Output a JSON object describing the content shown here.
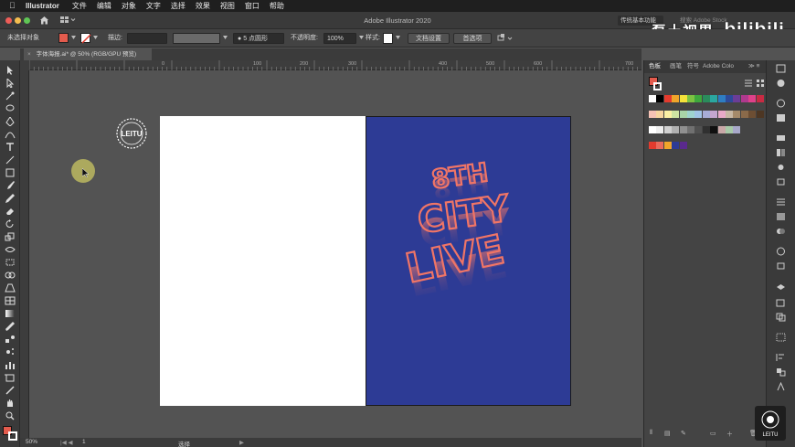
{
  "menubar": {
    "app_name": "Illustrator",
    "items": [
      "文件",
      "编辑",
      "对象",
      "文字",
      "选择",
      "效果",
      "视图",
      "窗口",
      "帮助"
    ]
  },
  "titlebar": {
    "title": "Adobe Illustrator 2020",
    "workspace": "传统基本功能",
    "search_placeholder": "搜索 Adobe Stock"
  },
  "watermark": {
    "text_cn": "磊土视界",
    "text_bili": "bilibili"
  },
  "control_bar": {
    "no_selection": "未选择对象",
    "stroke_label": "描边:",
    "brush_label": "5 点圆形",
    "opacity_label": "不透明度:",
    "opacity_value": "100%",
    "style_label": "样式:",
    "doc_setup_button": "文档设置",
    "preferences_button": "首选项",
    "fill_color": "#e35b4d"
  },
  "document_tab": {
    "title": "字体海报.ai* @ 50% (RGB/GPU 预览)"
  },
  "ruler_top_ticks": [
    "0",
    "100",
    "200",
    "300",
    "400",
    "500",
    "600",
    "700"
  ],
  "status_bar": {
    "zoom": "50%",
    "artboard_number": "1",
    "tool_name": "选择"
  },
  "artwork": {
    "lines": [
      "8TH",
      "CITY",
      "LIVE"
    ],
    "background_color": "#2d3b95",
    "text_color": "#e96a5c",
    "logo_text": "LEITU"
  },
  "swatches_panel": {
    "tabs": [
      "色板",
      "画笔",
      "符号",
      "Adobe Colo"
    ],
    "colors": [
      [
        "#ffffff",
        "#000000",
        "#e33b2e",
        "#f0a52a",
        "#f5e23a",
        "#7cc242",
        "#3ea83d",
        "#2a8c5c",
        "#2aa7a0",
        "#2e7dc2",
        "#2d4a9a",
        "#6b3d97",
        "#b0398e",
        "#e0418a",
        "#c92a43"
      ],
      [
        "#f6c2b5",
        "#f7d59f",
        "#fbf0a4",
        "#cfe4a2",
        "#a9d5a8",
        "#9fd4cf",
        "#a1c4e6",
        "#a7acd6",
        "#c4a6d0",
        "#e8a9c8",
        "#c7b7a4",
        "#a58a6a",
        "#8a6a4a",
        "#6d4e33",
        "#4d3623"
      ],
      [
        "#ffffff",
        "#eeeeee",
        "#d0d0d0",
        "#b0b0b0",
        "#909090",
        "#707070",
        "#505050",
        "#303030",
        "#101010",
        "#c9a8a8",
        "#a8c9a8",
        "#a8a8c9"
      ],
      [
        "#e33b2e",
        "#e96a5c",
        "#f0a52a",
        "#2d3b95",
        "#5a2a8e"
      ]
    ]
  },
  "colors": {
    "app_bg": "#535353",
    "accent": "#e96a5c"
  }
}
